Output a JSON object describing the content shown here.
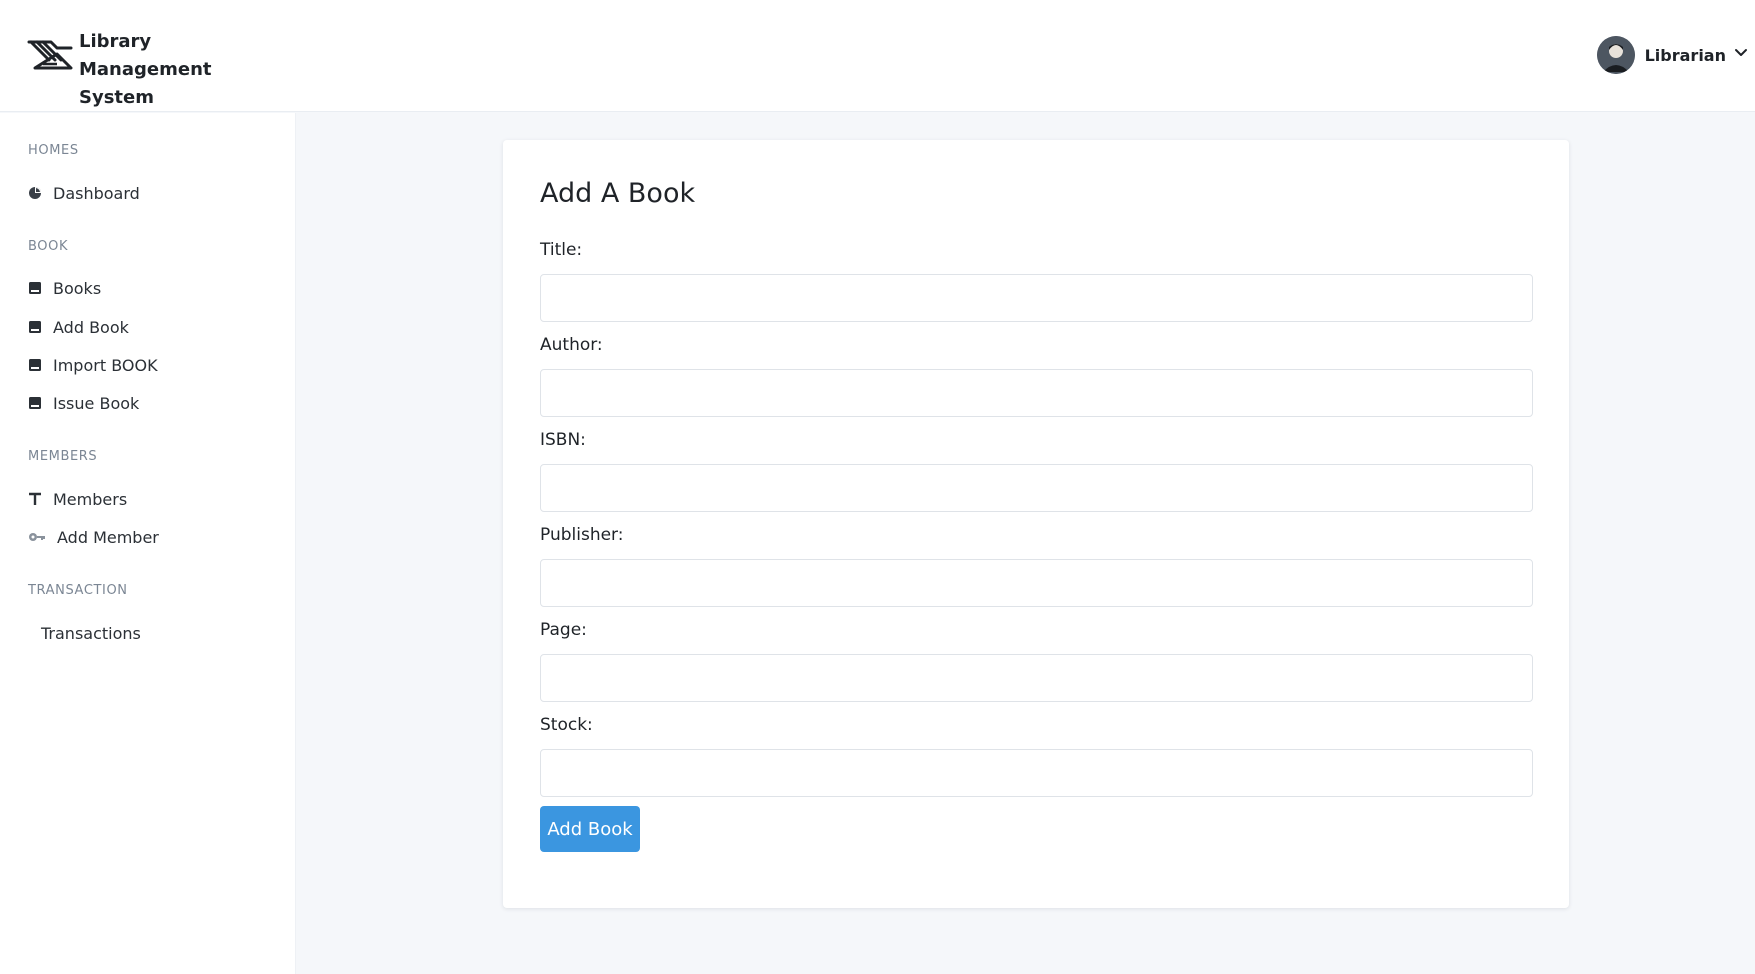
{
  "app": {
    "title": "Library Management System"
  },
  "user": {
    "name": "Librarian"
  },
  "sidebar": {
    "sections": [
      {
        "label": "HOMES",
        "items": [
          {
            "label": "Dashboard",
            "icon": "pie-chart-icon"
          }
        ]
      },
      {
        "label": "BOOK",
        "items": [
          {
            "label": "Books",
            "icon": "book-icon"
          },
          {
            "label": "Add Book",
            "icon": "book-icon"
          },
          {
            "label": "Import BOOK",
            "icon": "book-icon"
          },
          {
            "label": "Issue Book",
            "icon": "book-icon"
          }
        ]
      },
      {
        "label": "MEMBERS",
        "items": [
          {
            "label": "Members",
            "icon": "text-icon"
          },
          {
            "label": "Add Member",
            "icon": "key-icon"
          }
        ]
      },
      {
        "label": "TRANSACTION",
        "items": [
          {
            "label": "Transactions",
            "icon": ""
          }
        ]
      }
    ]
  },
  "form": {
    "title": "Add A Book",
    "fields": [
      {
        "label": "Title:",
        "value": ""
      },
      {
        "label": "Author:",
        "value": ""
      },
      {
        "label": "ISBN:",
        "value": ""
      },
      {
        "label": "Publisher:",
        "value": ""
      },
      {
        "label": "Page:",
        "value": ""
      },
      {
        "label": "Stock:",
        "value": ""
      }
    ],
    "submit_label": "Add Book"
  },
  "colors": {
    "accent": "#3b96e0",
    "background": "#f5f7fa",
    "section_label": "#7b8694"
  }
}
